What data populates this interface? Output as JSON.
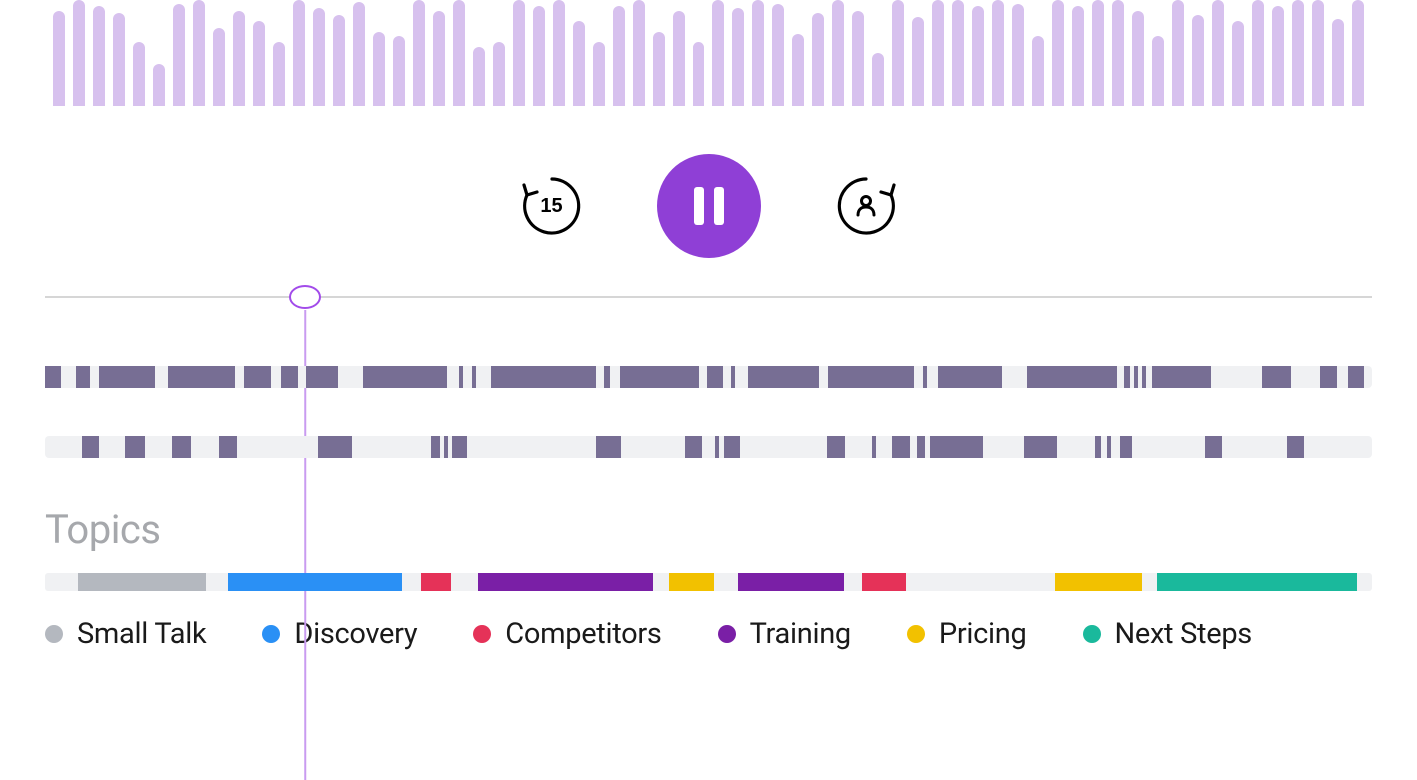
{
  "colors": {
    "accent": "#8f3fd6",
    "waveform_bar": "#d7c1ee",
    "playhead": "#c99bf0",
    "track_bg": "#f0f1f3",
    "track_seg": "#776e94"
  },
  "waveform": {
    "heights_pct": [
      90,
      100,
      94,
      88,
      60,
      40,
      96,
      100,
      74,
      90,
      80,
      60,
      100,
      92,
      86,
      98,
      70,
      66,
      100,
      90,
      100,
      56,
      60,
      100,
      94,
      100,
      80,
      60,
      94,
      100,
      70,
      90,
      60,
      100,
      92,
      100,
      96,
      68,
      88,
      100,
      90,
      50,
      100,
      84,
      100,
      100,
      94,
      100,
      96,
      66,
      100,
      94,
      100,
      100,
      90,
      66,
      100,
      86,
      100,
      80,
      100,
      94,
      100,
      100,
      82,
      100
    ]
  },
  "controls": {
    "rewind_label": "15",
    "rewind_name": "rewind-15-button",
    "pause_name": "pause-button",
    "forward_name": "skip-to-next-speaker-button"
  },
  "playhead": {
    "position_pct": 19.6
  },
  "speaker_tracks": [
    {
      "name": "speaker-1-track",
      "segments": [
        {
          "start": 0.0,
          "width": 1.2
        },
        {
          "start": 2.3,
          "width": 1.1
        },
        {
          "start": 4.1,
          "width": 4.2
        },
        {
          "start": 9.3,
          "width": 5.0
        },
        {
          "start": 15.0,
          "width": 2.0
        },
        {
          "start": 17.8,
          "width": 1.3
        },
        {
          "start": 19.7,
          "width": 2.4
        },
        {
          "start": 24.0,
          "width": 6.3
        },
        {
          "start": 31.2,
          "width": 0.3
        },
        {
          "start": 32.2,
          "width": 0.3
        },
        {
          "start": 33.6,
          "width": 7.9
        },
        {
          "start": 42.1,
          "width": 0.5
        },
        {
          "start": 43.3,
          "width": 6.0
        },
        {
          "start": 49.9,
          "width": 1.2
        },
        {
          "start": 51.7,
          "width": 0.3
        },
        {
          "start": 53.0,
          "width": 5.3
        },
        {
          "start": 59.0,
          "width": 6.5
        },
        {
          "start": 66.2,
          "width": 0.3
        },
        {
          "start": 67.3,
          "width": 4.8
        },
        {
          "start": 74.0,
          "width": 6.8
        },
        {
          "start": 81.3,
          "width": 0.5
        },
        {
          "start": 82.1,
          "width": 0.3
        },
        {
          "start": 82.7,
          "width": 0.3
        },
        {
          "start": 83.4,
          "width": 4.5
        },
        {
          "start": 91.7,
          "width": 2.2
        },
        {
          "start": 96.1,
          "width": 1.3
        },
        {
          "start": 98.2,
          "width": 1.2
        }
      ]
    },
    {
      "name": "speaker-2-track",
      "segments": [
        {
          "start": 2.8,
          "width": 1.3
        },
        {
          "start": 6.0,
          "width": 1.5
        },
        {
          "start": 9.6,
          "width": 1.4
        },
        {
          "start": 13.1,
          "width": 1.4
        },
        {
          "start": 20.6,
          "width": 2.5
        },
        {
          "start": 29.1,
          "width": 0.7
        },
        {
          "start": 30.1,
          "width": 0.3
        },
        {
          "start": 30.7,
          "width": 1.1
        },
        {
          "start": 41.5,
          "width": 1.9
        },
        {
          "start": 48.2,
          "width": 1.3
        },
        {
          "start": 50.5,
          "width": 0.3
        },
        {
          "start": 51.2,
          "width": 1.2
        },
        {
          "start": 58.9,
          "width": 1.4
        },
        {
          "start": 62.3,
          "width": 0.3
        },
        {
          "start": 63.8,
          "width": 1.4
        },
        {
          "start": 65.7,
          "width": 0.6
        },
        {
          "start": 66.7,
          "width": 4.0
        },
        {
          "start": 73.8,
          "width": 2.5
        },
        {
          "start": 79.1,
          "width": 0.5
        },
        {
          "start": 80.0,
          "width": 0.3
        },
        {
          "start": 81.0,
          "width": 0.9
        },
        {
          "start": 87.4,
          "width": 1.3
        },
        {
          "start": 93.6,
          "width": 1.3
        }
      ]
    }
  ],
  "topics_section": {
    "heading": "Topics",
    "timeline": [
      {
        "start": 2.5,
        "width": 9.6,
        "topic": "small_talk"
      },
      {
        "start": 13.8,
        "width": 13.1,
        "topic": "discovery"
      },
      {
        "start": 28.3,
        "width": 2.3,
        "topic": "competitors"
      },
      {
        "start": 32.6,
        "width": 13.2,
        "topic": "training"
      },
      {
        "start": 47.0,
        "width": 3.4,
        "topic": "pricing"
      },
      {
        "start": 52.2,
        "width": 8.0,
        "topic": "training"
      },
      {
        "start": 61.6,
        "width": 3.3,
        "topic": "competitors"
      },
      {
        "start": 76.1,
        "width": 6.6,
        "topic": "pricing"
      },
      {
        "start": 83.8,
        "width": 15.1,
        "topic": "next_steps"
      }
    ],
    "legend": [
      {
        "key": "small_talk",
        "label": "Small Talk",
        "color": "#b4b8bf"
      },
      {
        "key": "discovery",
        "label": "Discovery",
        "color": "#2a90f5"
      },
      {
        "key": "competitors",
        "label": "Competitors",
        "color": "#e53258"
      },
      {
        "key": "training",
        "label": "Training",
        "color": "#7a1fa6"
      },
      {
        "key": "pricing",
        "label": "Pricing",
        "color": "#f2c100"
      },
      {
        "key": "next_steps",
        "label": "Next Steps",
        "color": "#1ab99c"
      }
    ]
  }
}
